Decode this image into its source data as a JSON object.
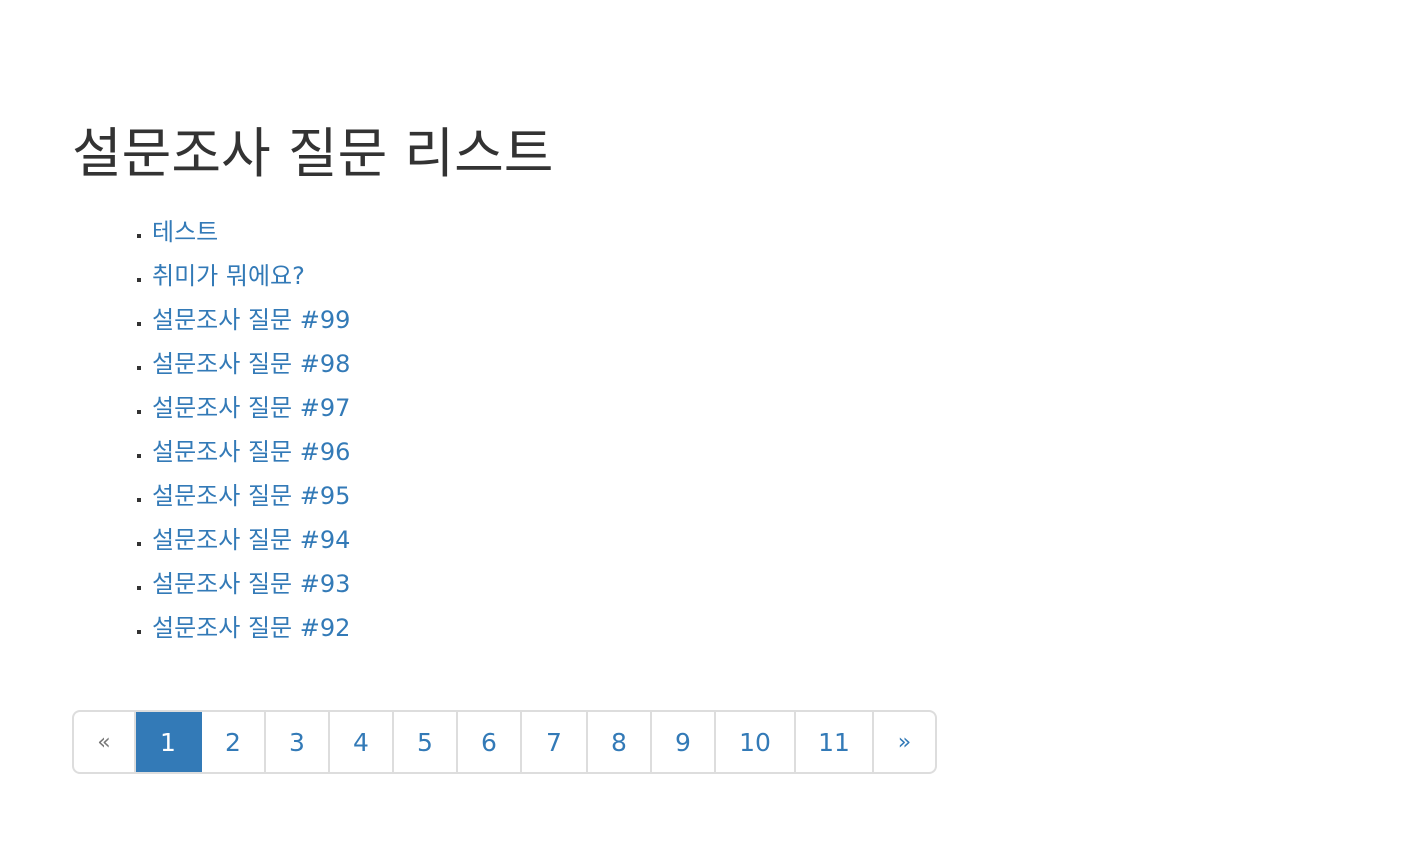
{
  "page": {
    "title": "설문조사 질문 리스트"
  },
  "questions": [
    "테스트",
    "취미가 뭐에요?",
    "설문조사 질문 #99",
    "설문조사 질문 #98",
    "설문조사 질문 #97",
    "설문조사 질문 #96",
    "설문조사 질문 #95",
    "설문조사 질문 #94",
    "설문조사 질문 #93",
    "설문조사 질문 #92"
  ],
  "pagination": {
    "prev_label": "«",
    "next_label": "»",
    "pages": [
      "1",
      "2",
      "3",
      "4",
      "5",
      "6",
      "7",
      "8",
      "9",
      "10",
      "11"
    ],
    "active_page": "1"
  },
  "colors": {
    "link": "#337ab7",
    "active_bg": "#337ab7",
    "border": "#dddddd",
    "text": "#333333"
  }
}
